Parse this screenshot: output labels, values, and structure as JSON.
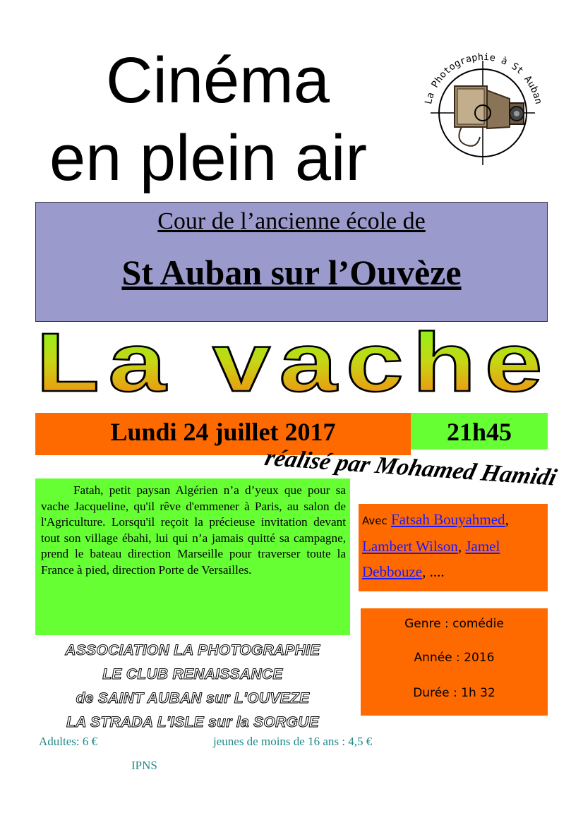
{
  "header": {
    "title_line1": "Cinéma",
    "title_line2": "en plein air"
  },
  "logo": {
    "text": "La Photographie à St Auban",
    "icon": "camera-icon"
  },
  "venue": {
    "line1": "Cour de l’ancienne école de",
    "line2": " St Auban sur l’Ouvèze"
  },
  "film": {
    "title": "La vache",
    "director": "réalisé par Mohamed Hamidi"
  },
  "schedule": {
    "date": "Lundi 24 juillet 2017",
    "time": "21h45"
  },
  "synopsis": {
    "text": "Fatah, petit paysan Algérien n’a d’yeux que pour sa vache Jacqueline, qu'il rêve d'emmener à Paris, au salon de l'Agriculture. Lorsqu'il reçoit la précieuse invitation devant tout son village ébahi, lui qui n’a jamais quitté sa campagne, prend le bateau direction Marseille pour traverser toute la France à pied, direction Porte de Versailles."
  },
  "cast": {
    "lead": "Avec",
    "actors": [
      "Fatsah Bouyahmed",
      "Lambert Wilson",
      "Jamel Debbouze"
    ],
    "sep": ",",
    "ellipsis": ", ...."
  },
  "info": {
    "genre": "Genre : comédie",
    "year": "Année : 2016",
    "duration": "Durée : 1h 32"
  },
  "organizers": [
    "ASSOCIATION LA PHOTOGRAPHIE",
    "LE CLUB RENAISSANCE",
    "de SAINT AUBAN sur L'OUVEZE",
    "LA STRADA L'ISLE sur la SORGUE"
  ],
  "prices": {
    "adults": "Adultes: 6 €",
    "youth": "jeunes de moins de 16 ans : 4,5 €"
  },
  "footer": {
    "ipns": "IPNS"
  },
  "colors": {
    "orange": "#ff6a00",
    "green": "#66ff33",
    "lavender": "#9a9acd",
    "teal_text": "#1f8a8a",
    "link": "#1a1aff"
  }
}
